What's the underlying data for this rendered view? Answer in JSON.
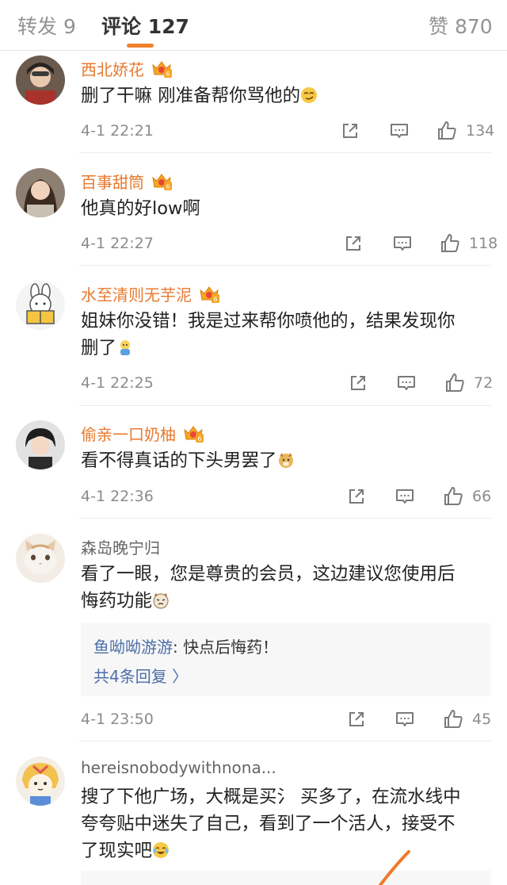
{
  "tabs": {
    "repost_label": "转发",
    "repost_count": "9",
    "comment_label": "评论",
    "comment_count": "127",
    "like_label": "赞",
    "like_count": "870"
  },
  "colors": {
    "accent": "#f0812d",
    "vip_name": "#e8792f",
    "link": "#4a6ea9"
  },
  "comments": [
    {
      "username": "西北娇花",
      "vip": true,
      "text": "删了干嘛 刚准备帮你骂他的",
      "emoji": "smirk-emoji",
      "time": "4-1 22:21",
      "likes": "134"
    },
    {
      "username": "百事甜筒",
      "vip": true,
      "text": "他真的好low啊",
      "time": "4-1 22:27",
      "likes": "118"
    },
    {
      "username": "水至清则无芋泥",
      "vip": true,
      "text_line1": "姐妹你没错！我是过来帮你喷他的，结果发现你",
      "text_line2": "删了",
      "emoji": "doll-emoji",
      "time": "4-1 22:25",
      "likes": "72"
    },
    {
      "username": "偷亲一口奶柚",
      "vip": true,
      "text": "看不得真话的下头男罢了",
      "emoji": "doge-emoji",
      "time": "4-1 22:36",
      "likes": "66"
    },
    {
      "username": "森岛晚宁归",
      "vip": false,
      "text_line1": "看了一眼，您是尊贵的会员，这边建议您使用后",
      "text_line2": "悔药功能",
      "emoji": "cat-emoji",
      "reply_user": "鱼呦呦游游",
      "reply_text": ": 快点后悔药！",
      "reply_more": "共4条回复 〉",
      "time": "4-1 23:50",
      "likes": "45"
    },
    {
      "username": "hereisnobodywithnona...",
      "vip": false,
      "text_line1": "搜了下他广场，大概是买氵 买多了，在流水线中",
      "text_line2": "夸夸贴中迷失了自己，看到了一个活人，接受不",
      "text_line3": "了现实吧",
      "emoji": "laugh-cry-emoji"
    }
  ]
}
